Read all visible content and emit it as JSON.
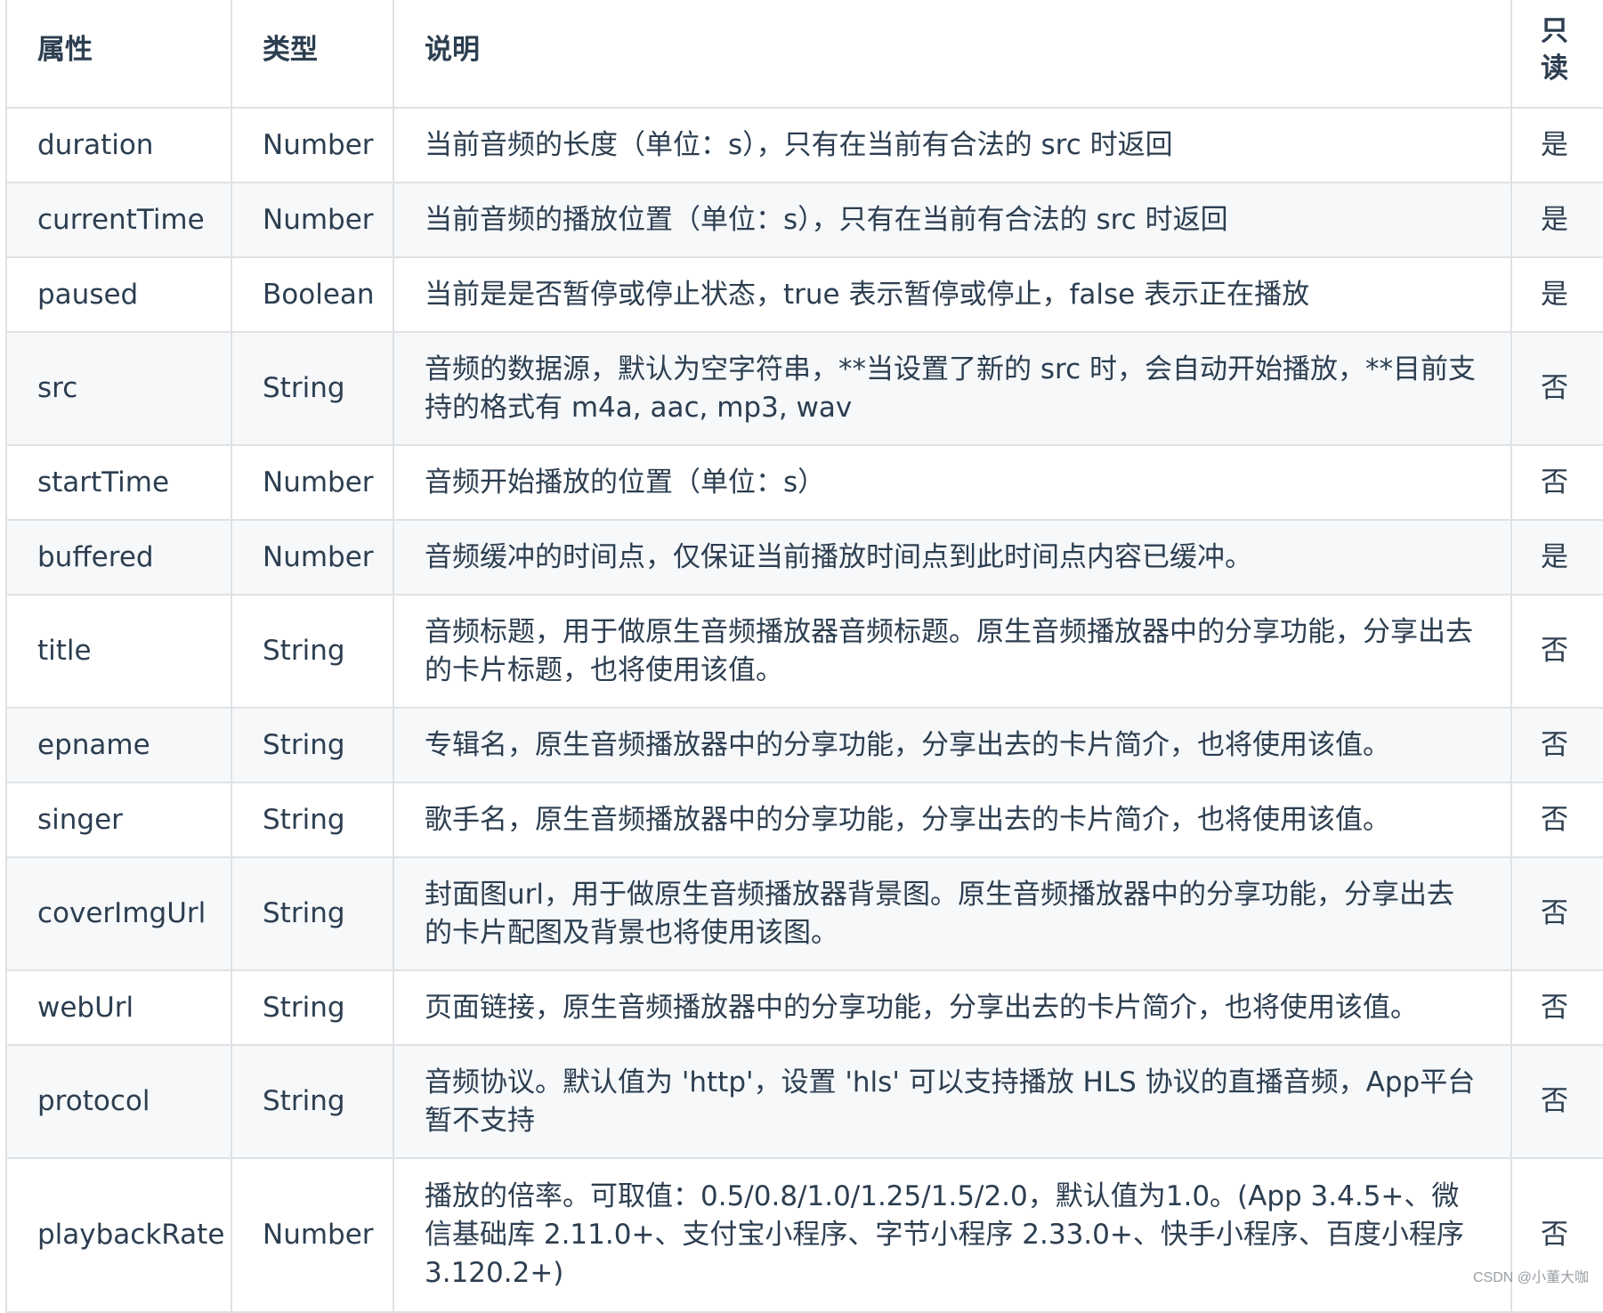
{
  "table": {
    "headers": {
      "attr": "属性",
      "type": "类型",
      "desc": "说明",
      "readonly": "只读"
    },
    "rows": [
      {
        "attr": "duration",
        "type": "Number",
        "desc": "当前音频的长度（单位：s），只有在当前有合法的 src 时返回",
        "readonly": "是"
      },
      {
        "attr": "currentTime",
        "type": "Number",
        "desc": "当前音频的播放位置（单位：s），只有在当前有合法的 src 时返回",
        "readonly": "是"
      },
      {
        "attr": "paused",
        "type": "Boolean",
        "desc": "当前是是否暂停或停止状态，true 表示暂停或停止，false 表示正在播放",
        "readonly": "是"
      },
      {
        "attr": "src",
        "type": "String",
        "desc": "音频的数据源，默认为空字符串，**当设置了新的 src 时，会自动开始播放，**目前支持的格式有 m4a, aac, mp3, wav",
        "readonly": "否"
      },
      {
        "attr": "startTime",
        "type": "Number",
        "desc": "音频开始播放的位置（单位：s）",
        "readonly": "否"
      },
      {
        "attr": "buffered",
        "type": "Number",
        "desc": "音频缓冲的时间点，仅保证当前播放时间点到此时间点内容已缓冲。",
        "readonly": "是"
      },
      {
        "attr": "title",
        "type": "String",
        "desc": "音频标题，用于做原生音频播放器音频标题。原生音频播放器中的分享功能，分享出去的卡片标题，也将使用该值。",
        "readonly": "否"
      },
      {
        "attr": "epname",
        "type": "String",
        "desc": "专辑名，原生音频播放器中的分享功能，分享出去的卡片简介，也将使用该值。",
        "readonly": "否"
      },
      {
        "attr": "singer",
        "type": "String",
        "desc": "歌手名，原生音频播放器中的分享功能，分享出去的卡片简介，也将使用该值。",
        "readonly": "否"
      },
      {
        "attr": "coverImgUrl",
        "type": "String",
        "desc": "封面图url，用于做原生音频播放器背景图。原生音频播放器中的分享功能，分享出去的卡片配图及背景也将使用该图。",
        "readonly": "否"
      },
      {
        "attr": "webUrl",
        "type": "String",
        "desc": "页面链接，原生音频播放器中的分享功能，分享出去的卡片简介，也将使用该值。",
        "readonly": "否"
      },
      {
        "attr": "protocol",
        "type": "String",
        "desc": "音频协议。默认值为 'http'，设置 'hls' 可以支持播放 HLS 协议的直播音频，App平台暂不支持",
        "readonly": "否"
      },
      {
        "attr": "playbackRate",
        "type": "Number",
        "desc": "播放的倍率。可取值：0.5/0.8/1.0/1.25/1.5/2.0，默认值为1.0。(App 3.4.5+、微信基础库 2.11.0+、支付宝小程序、字节小程序 2.33.0+、快手小程序、百度小程序 3.120.2+)",
        "readonly": "否"
      }
    ]
  },
  "watermark": "CSDN @小董大咖"
}
